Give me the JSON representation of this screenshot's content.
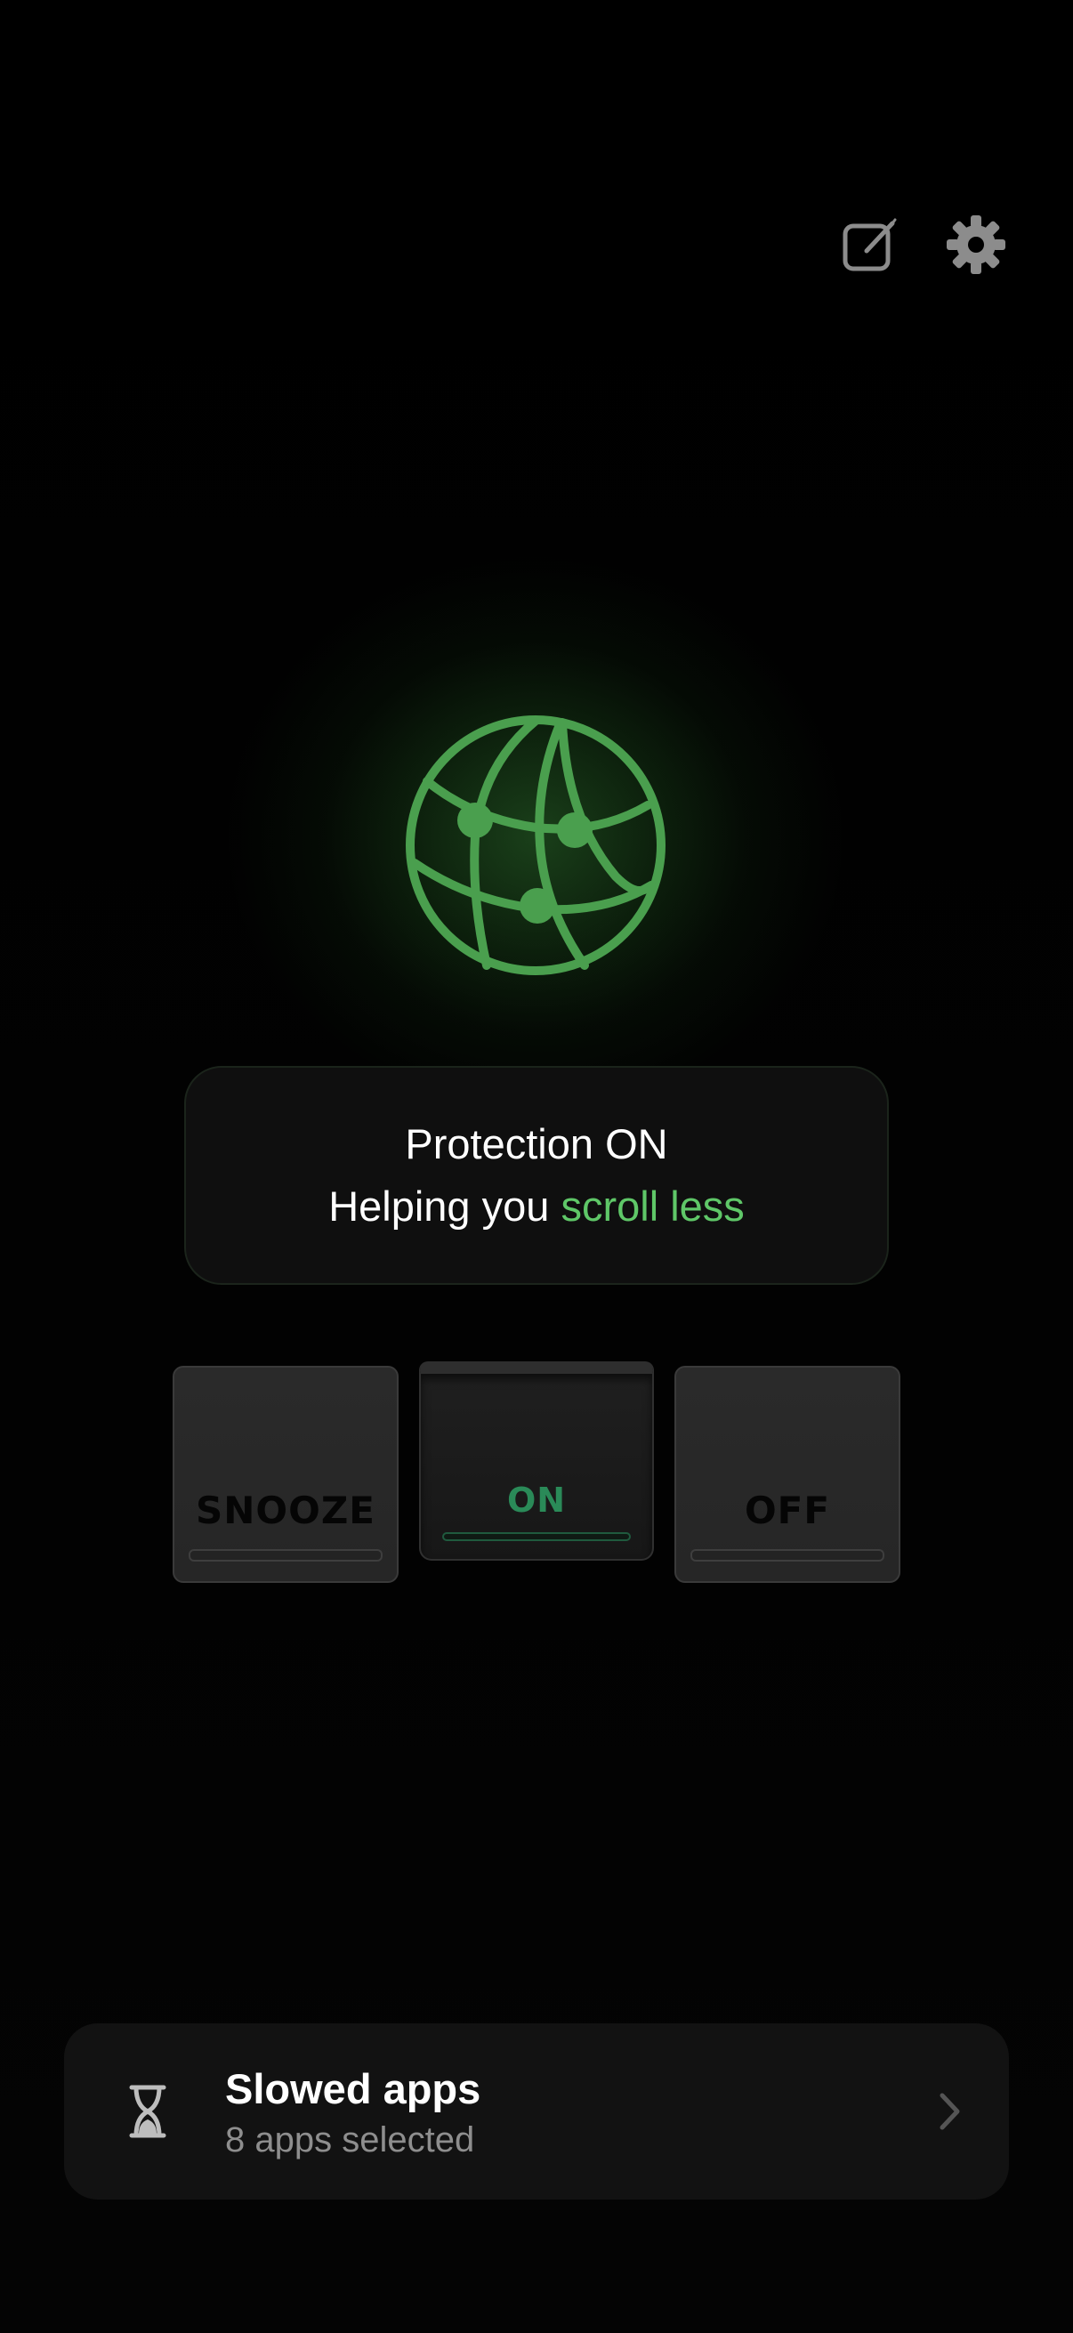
{
  "toolbar": {
    "edit_icon": "edit-icon",
    "settings_icon": "gear-icon"
  },
  "hero": {
    "icon": "globe-network-icon",
    "glow_color": "#4caf50",
    "icon_color": "#4a9f4e"
  },
  "status": {
    "title": "Protection ON",
    "subtitle_prefix": "Helping you ",
    "subtitle_accent": "scroll less",
    "accent_color": "#5fc768"
  },
  "modes": {
    "selected": "ON",
    "options": [
      {
        "label": "SNOOZE"
      },
      {
        "label": "ON"
      },
      {
        "label": "OFF"
      }
    ]
  },
  "slowed_apps": {
    "icon": "hourglass-icon",
    "title": "Slowed apps",
    "subtitle": "8 apps selected",
    "chevron": "chevron-right-icon"
  }
}
